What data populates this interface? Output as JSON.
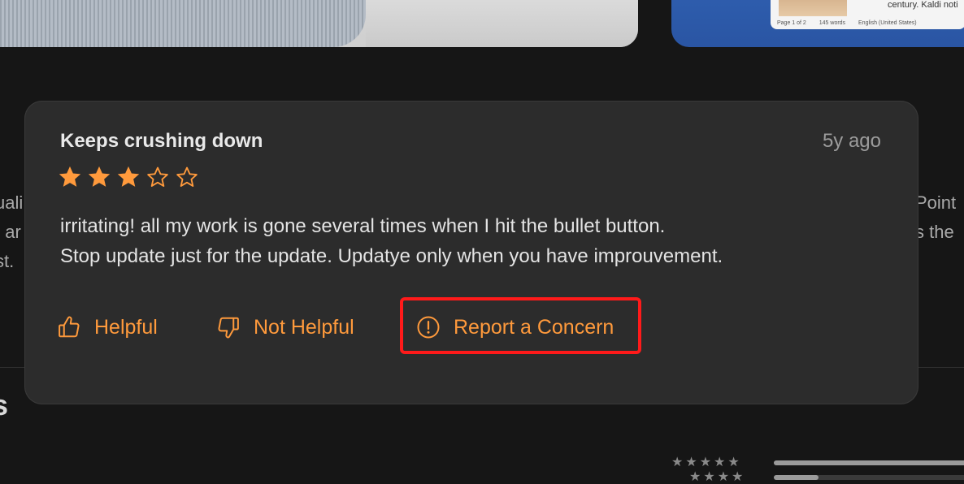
{
  "background": {
    "doc_preview": {
      "snippet": "century. Kaldi noti",
      "status": [
        "Page 1 of 2",
        "145 words",
        "English (United States)"
      ]
    },
    "side_left_lines": [
      "uali",
      ", ar",
      "st."
    ],
    "side_right_lines": [
      "Point",
      "s the"
    ],
    "section_heading_stub": "s"
  },
  "review": {
    "title": "Keeps crushing down",
    "date": "5y ago",
    "rating": 3,
    "rating_max": 5,
    "body_lines": [
      "irritating! all my work is gone several times when I hit the bullet button.",
      "Stop update just for the update. Updatye only when you have improuvement."
    ],
    "actions": {
      "helpful": "Helpful",
      "not_helpful": "Not Helpful",
      "report": "Report a Concern"
    }
  },
  "histogram": {
    "rows": [
      {
        "stars": "★★★★★",
        "fraction": 1.0
      },
      {
        "stars": "★★★★",
        "fraction": 0.21
      }
    ]
  },
  "colors": {
    "accent": "#ff9a3c",
    "highlight": "#ff1a1a",
    "card": "#2c2c2c",
    "background": "#161616"
  },
  "icons": {
    "helpful": "thumbs-up-icon",
    "not_helpful": "thumbs-down-icon",
    "report": "exclamation-circle-icon",
    "star_filled": "star-filled-icon",
    "star_empty": "star-outline-icon"
  }
}
